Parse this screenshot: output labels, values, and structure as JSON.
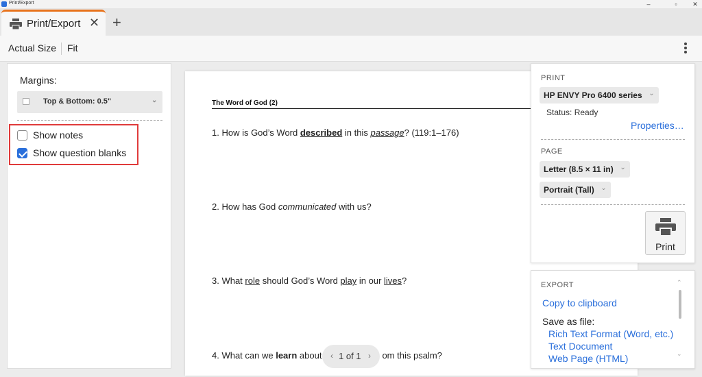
{
  "window": {
    "title": "Print/Export",
    "min": "–",
    "max": "▫",
    "close": "✕"
  },
  "tab": {
    "label": "Print/Export",
    "close": "✕",
    "new": "+"
  },
  "toolbar": {
    "actual_size": "Actual Size",
    "fit": "Fit"
  },
  "left": {
    "margins_label": "Margins:",
    "margins_value": "Top & Bottom:  0.5\"",
    "options": [
      {
        "label": "Show notes",
        "checked": false
      },
      {
        "label": "Show question blanks",
        "checked": true
      }
    ]
  },
  "doc": {
    "title": "The Word of God (2)",
    "q1": {
      "a": "1. How is God’s Word ",
      "b": "described",
      "c": " in this ",
      "d": "passage",
      "e": "? (119:1–176)"
    },
    "q2": {
      "a": "2. How has God ",
      "b": "communicated",
      "c": " with us?"
    },
    "q3": {
      "a": "3. What ",
      "b": "role",
      "c": " should God’s Word ",
      "d": "play",
      "e": " in our ",
      "f": "lives",
      "g": "?"
    },
    "q4": {
      "a": "4. What can we ",
      "b": "learn",
      "c": " about",
      "d": "om this psalm?"
    }
  },
  "pager": {
    "prev": "‹",
    "count": "1 of 1",
    "next": "›"
  },
  "print": {
    "section": "PRINT",
    "printer": "HP ENVY Pro 6400 series",
    "status": "Status:  Ready",
    "properties": "Properties…",
    "page_section": "PAGE",
    "paper": "Letter (8.5 × 11 in)",
    "orientation": "Portrait (Tall)",
    "print_button": "Print"
  },
  "export": {
    "section": "EXPORT",
    "copy": "Copy to clipboard",
    "save_as": "Save as file:",
    "formats": [
      "Rich Text Format (Word, etc.)",
      "Text Document",
      "Web Page (HTML)"
    ]
  },
  "colors": {
    "accent": "#2a6fdb",
    "tab_indicator": "#e8731c",
    "highlight": "#e03a3a"
  }
}
